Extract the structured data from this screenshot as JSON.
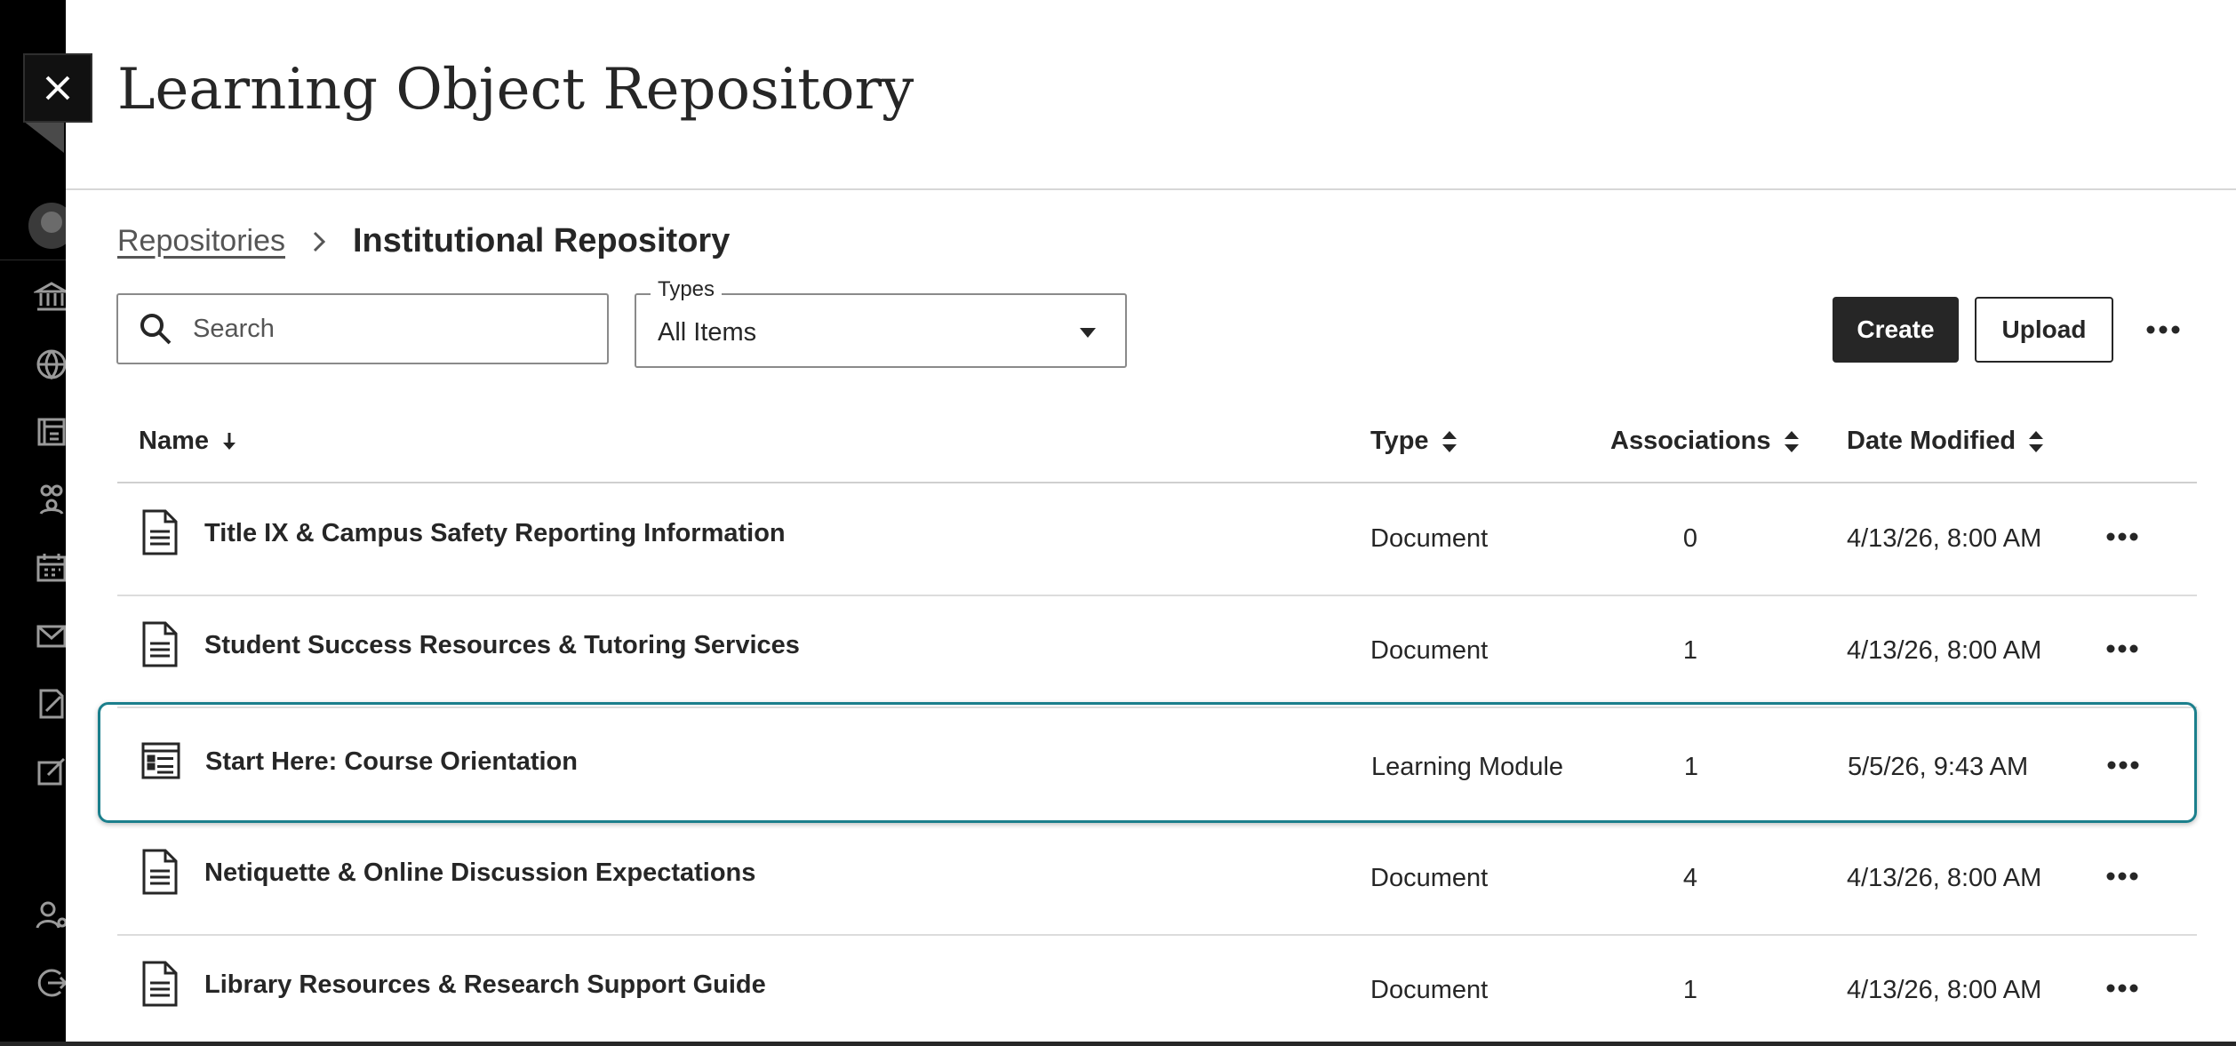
{
  "panel": {
    "title": "Learning Object Repository"
  },
  "breadcrumb": {
    "parent": "Repositories",
    "current": "Institutional Repository"
  },
  "search": {
    "placeholder": "Search",
    "value": ""
  },
  "types_filter": {
    "label": "Types",
    "selected": "All Items"
  },
  "actions": {
    "create_label": "Create",
    "upload_label": "Upload"
  },
  "table": {
    "columns": {
      "name": "Name",
      "type": "Type",
      "associations": "Associations",
      "date_modified": "Date Modified"
    },
    "rows": [
      {
        "icon": "document-icon",
        "name": "Title IX & Campus Safety Reporting Information",
        "type": "Document",
        "associations": "0",
        "date_modified": "4/13/26, 8:00 AM"
      },
      {
        "icon": "document-icon",
        "name": "Student Success Resources & Tutoring Services",
        "type": "Document",
        "associations": "1",
        "date_modified": "4/13/26, 8:00 AM"
      },
      {
        "icon": "learning-module-icon",
        "name": "Start Here: Course Orientation",
        "type": "Learning Module",
        "associations": "1",
        "date_modified": "5/5/26, 9:43 AM",
        "selected": true
      },
      {
        "icon": "document-icon",
        "name": "Netiquette & Online Discussion Expectations",
        "type": "Document",
        "associations": "4",
        "date_modified": "4/13/26, 8:00 AM"
      },
      {
        "icon": "document-icon",
        "name": "Library Resources & Research Support Guide",
        "type": "Document",
        "associations": "1",
        "date_modified": "4/13/26, 8:00 AM"
      }
    ]
  },
  "colors": {
    "selected_border": "#1b7f8c",
    "primary_button": "#262626",
    "rail": "#000000"
  }
}
